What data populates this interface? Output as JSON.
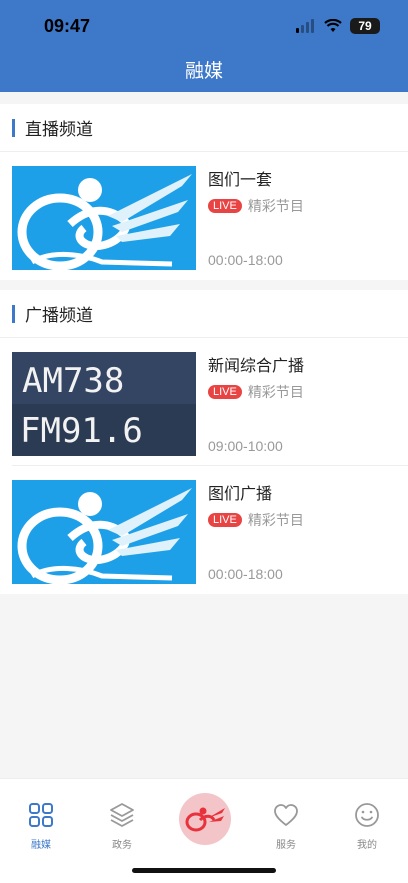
{
  "status_bar": {
    "time": "09:47",
    "battery": "79"
  },
  "header": {
    "title": "融媒"
  },
  "sections": [
    {
      "title": "直播频道",
      "items": [
        {
          "title": "图们一套",
          "badge": "LIVE",
          "program": "精彩节目",
          "time": "00:00-18:00",
          "thumb": "logo"
        }
      ]
    },
    {
      "title": "广播频道",
      "items": [
        {
          "title": "新闻综合广播",
          "badge": "LIVE",
          "program": "精彩节目",
          "time": "09:00-10:00",
          "thumb": "radio",
          "thumb_text": [
            "AM738",
            "FM91.6"
          ]
        },
        {
          "title": "图们广播",
          "badge": "LIVE",
          "program": "精彩节目",
          "time": "00:00-18:00",
          "thumb": "logo"
        }
      ]
    }
  ],
  "tabbar": {
    "items": [
      {
        "label": "融媒",
        "icon": "grid-icon",
        "active": true
      },
      {
        "label": "政务",
        "icon": "layers-icon",
        "active": false
      },
      {
        "label": "",
        "icon": "center-logo-icon",
        "active": false
      },
      {
        "label": "服务",
        "icon": "heart-icon",
        "active": false
      },
      {
        "label": "我的",
        "icon": "smiley-icon",
        "active": false
      }
    ]
  },
  "colors": {
    "primary": "#3d78c9",
    "live": "#e94444",
    "thumb_blue": "#1ea0e8"
  }
}
